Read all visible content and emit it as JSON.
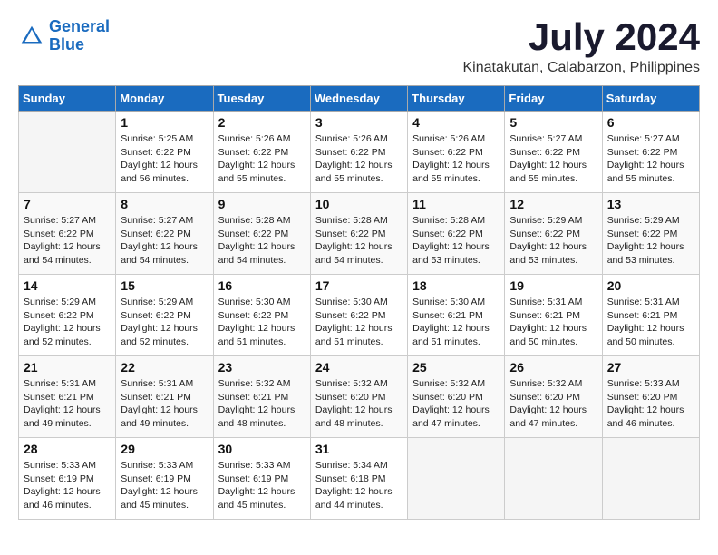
{
  "header": {
    "logo_line1": "General",
    "logo_line2": "Blue",
    "month_title": "July 2024",
    "location": "Kinatakutan, Calabarzon, Philippines"
  },
  "days_of_week": [
    "Sunday",
    "Monday",
    "Tuesday",
    "Wednesday",
    "Thursday",
    "Friday",
    "Saturday"
  ],
  "weeks": [
    [
      {
        "day": "",
        "empty": true
      },
      {
        "day": "1",
        "sunrise": "5:25 AM",
        "sunset": "6:22 PM",
        "daylight": "12 hours and 56 minutes."
      },
      {
        "day": "2",
        "sunrise": "5:26 AM",
        "sunset": "6:22 PM",
        "daylight": "12 hours and 55 minutes."
      },
      {
        "day": "3",
        "sunrise": "5:26 AM",
        "sunset": "6:22 PM",
        "daylight": "12 hours and 55 minutes."
      },
      {
        "day": "4",
        "sunrise": "5:26 AM",
        "sunset": "6:22 PM",
        "daylight": "12 hours and 55 minutes."
      },
      {
        "day": "5",
        "sunrise": "5:27 AM",
        "sunset": "6:22 PM",
        "daylight": "12 hours and 55 minutes."
      },
      {
        "day": "6",
        "sunrise": "5:27 AM",
        "sunset": "6:22 PM",
        "daylight": "12 hours and 55 minutes."
      }
    ],
    [
      {
        "day": "7",
        "sunrise": "5:27 AM",
        "sunset": "6:22 PM",
        "daylight": "12 hours and 54 minutes."
      },
      {
        "day": "8",
        "sunrise": "5:27 AM",
        "sunset": "6:22 PM",
        "daylight": "12 hours and 54 minutes."
      },
      {
        "day": "9",
        "sunrise": "5:28 AM",
        "sunset": "6:22 PM",
        "daylight": "12 hours and 54 minutes."
      },
      {
        "day": "10",
        "sunrise": "5:28 AM",
        "sunset": "6:22 PM",
        "daylight": "12 hours and 54 minutes."
      },
      {
        "day": "11",
        "sunrise": "5:28 AM",
        "sunset": "6:22 PM",
        "daylight": "12 hours and 53 minutes."
      },
      {
        "day": "12",
        "sunrise": "5:29 AM",
        "sunset": "6:22 PM",
        "daylight": "12 hours and 53 minutes."
      },
      {
        "day": "13",
        "sunrise": "5:29 AM",
        "sunset": "6:22 PM",
        "daylight": "12 hours and 53 minutes."
      }
    ],
    [
      {
        "day": "14",
        "sunrise": "5:29 AM",
        "sunset": "6:22 PM",
        "daylight": "12 hours and 52 minutes."
      },
      {
        "day": "15",
        "sunrise": "5:29 AM",
        "sunset": "6:22 PM",
        "daylight": "12 hours and 52 minutes."
      },
      {
        "day": "16",
        "sunrise": "5:30 AM",
        "sunset": "6:22 PM",
        "daylight": "12 hours and 51 minutes."
      },
      {
        "day": "17",
        "sunrise": "5:30 AM",
        "sunset": "6:22 PM",
        "daylight": "12 hours and 51 minutes."
      },
      {
        "day": "18",
        "sunrise": "5:30 AM",
        "sunset": "6:21 PM",
        "daylight": "12 hours and 51 minutes."
      },
      {
        "day": "19",
        "sunrise": "5:31 AM",
        "sunset": "6:21 PM",
        "daylight": "12 hours and 50 minutes."
      },
      {
        "day": "20",
        "sunrise": "5:31 AM",
        "sunset": "6:21 PM",
        "daylight": "12 hours and 50 minutes."
      }
    ],
    [
      {
        "day": "21",
        "sunrise": "5:31 AM",
        "sunset": "6:21 PM",
        "daylight": "12 hours and 49 minutes."
      },
      {
        "day": "22",
        "sunrise": "5:31 AM",
        "sunset": "6:21 PM",
        "daylight": "12 hours and 49 minutes."
      },
      {
        "day": "23",
        "sunrise": "5:32 AM",
        "sunset": "6:21 PM",
        "daylight": "12 hours and 48 minutes."
      },
      {
        "day": "24",
        "sunrise": "5:32 AM",
        "sunset": "6:20 PM",
        "daylight": "12 hours and 48 minutes."
      },
      {
        "day": "25",
        "sunrise": "5:32 AM",
        "sunset": "6:20 PM",
        "daylight": "12 hours and 47 minutes."
      },
      {
        "day": "26",
        "sunrise": "5:32 AM",
        "sunset": "6:20 PM",
        "daylight": "12 hours and 47 minutes."
      },
      {
        "day": "27",
        "sunrise": "5:33 AM",
        "sunset": "6:20 PM",
        "daylight": "12 hours and 46 minutes."
      }
    ],
    [
      {
        "day": "28",
        "sunrise": "5:33 AM",
        "sunset": "6:19 PM",
        "daylight": "12 hours and 46 minutes."
      },
      {
        "day": "29",
        "sunrise": "5:33 AM",
        "sunset": "6:19 PM",
        "daylight": "12 hours and 45 minutes."
      },
      {
        "day": "30",
        "sunrise": "5:33 AM",
        "sunset": "6:19 PM",
        "daylight": "12 hours and 45 minutes."
      },
      {
        "day": "31",
        "sunrise": "5:34 AM",
        "sunset": "6:18 PM",
        "daylight": "12 hours and 44 minutes."
      },
      {
        "day": "",
        "empty": true
      },
      {
        "day": "",
        "empty": true
      },
      {
        "day": "",
        "empty": true
      }
    ]
  ]
}
